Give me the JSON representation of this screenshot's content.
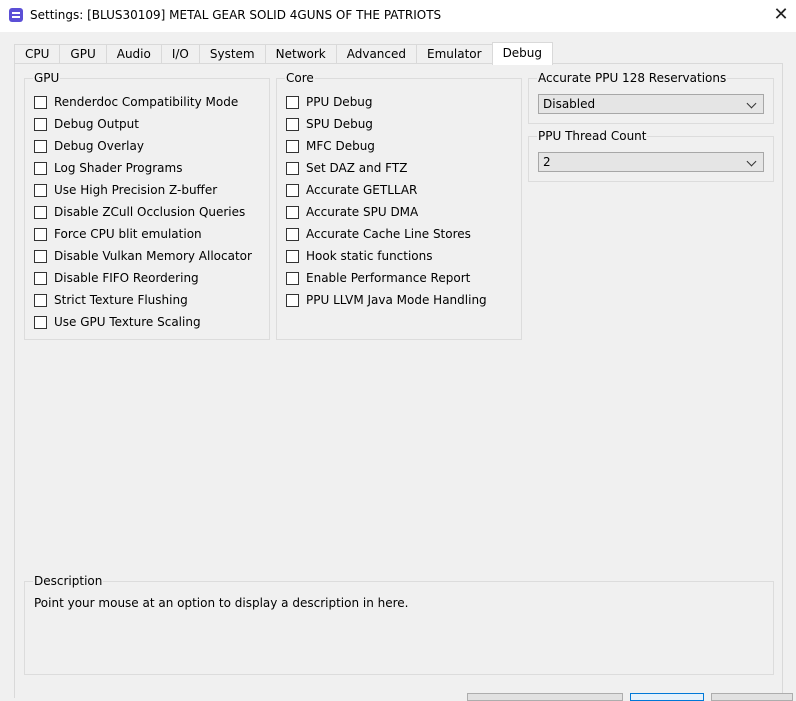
{
  "window": {
    "title": "Settings: [BLUS30109] METAL GEAR SOLID 4GUNS OF THE PATRIOTS",
    "close_glyph": "✕"
  },
  "tabs": [
    {
      "label": "CPU"
    },
    {
      "label": "GPU"
    },
    {
      "label": "Audio"
    },
    {
      "label": "I/O"
    },
    {
      "label": "System"
    },
    {
      "label": "Network"
    },
    {
      "label": "Advanced"
    },
    {
      "label": "Emulator"
    },
    {
      "label": "Debug",
      "active": true
    }
  ],
  "gpu_group": {
    "title": "GPU",
    "options": [
      {
        "label": "Renderdoc Compatibility Mode",
        "checked": false
      },
      {
        "label": "Debug Output",
        "checked": false
      },
      {
        "label": "Debug Overlay",
        "checked": false
      },
      {
        "label": "Log Shader Programs",
        "checked": false
      },
      {
        "label": "Use High Precision Z-buffer",
        "checked": false
      },
      {
        "label": "Disable ZCull Occlusion Queries",
        "checked": false
      },
      {
        "label": "Force CPU blit emulation",
        "checked": false
      },
      {
        "label": "Disable Vulkan Memory Allocator",
        "checked": false
      },
      {
        "label": "Disable FIFO Reordering",
        "checked": false
      },
      {
        "label": "Strict Texture Flushing",
        "checked": false
      },
      {
        "label": "Use GPU Texture Scaling",
        "checked": false
      }
    ]
  },
  "core_group": {
    "title": "Core",
    "options": [
      {
        "label": "PPU Debug",
        "checked": false
      },
      {
        "label": "SPU Debug",
        "checked": false
      },
      {
        "label": "MFC Debug",
        "checked": false
      },
      {
        "label": "Set DAZ and FTZ",
        "checked": false
      },
      {
        "label": "Accurate GETLLAR",
        "checked": false
      },
      {
        "label": "Accurate SPU DMA",
        "checked": false
      },
      {
        "label": "Accurate Cache Line Stores",
        "checked": false
      },
      {
        "label": "Hook static functions",
        "checked": false
      },
      {
        "label": "Enable Performance Report",
        "checked": false
      },
      {
        "label": "PPU LLVM Java Mode Handling",
        "checked": false
      }
    ]
  },
  "ppu128": {
    "title": "Accurate PPU 128 Reservations",
    "value": "Disabled"
  },
  "ppu_threads": {
    "title": "PPU Thread Count",
    "value": "2"
  },
  "description": {
    "title": "Description",
    "text": "Point your mouse at an option to display a description in here."
  },
  "icons": {
    "app": "rpcs3-app-icon",
    "close": "close-icon",
    "dropdown": "chevron-down-icon"
  }
}
